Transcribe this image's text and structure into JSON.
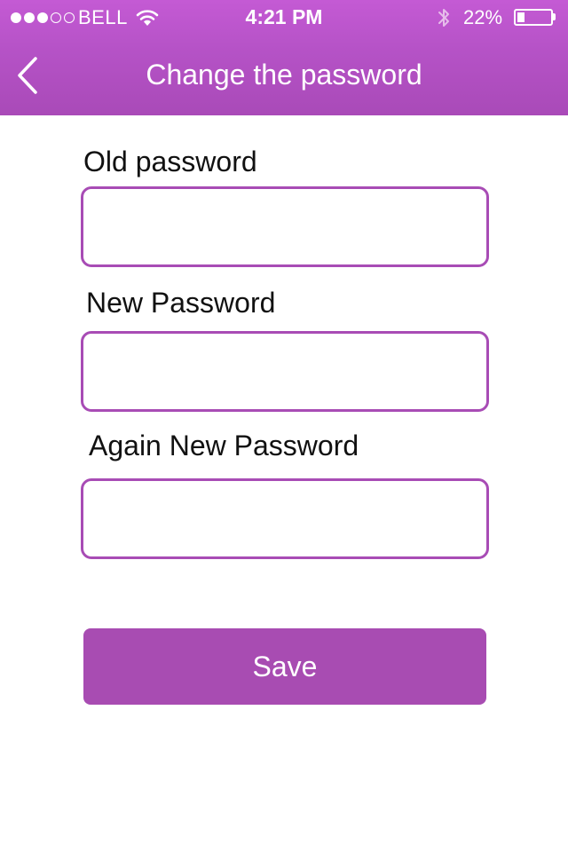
{
  "status_bar": {
    "carrier": "BELL",
    "time": "4:21 PM",
    "battery_percent": "22%",
    "battery_level": 0.22,
    "signal_strength": 3,
    "signal_max": 5,
    "icons": [
      "wifi-icon",
      "bluetooth-icon",
      "battery-icon"
    ]
  },
  "nav": {
    "title": "Change the password",
    "back_icon": "chevron-left-icon"
  },
  "form": {
    "old_password": {
      "label": "Old password",
      "value": "",
      "placeholder": ""
    },
    "new_password": {
      "label": "New Password",
      "value": "",
      "placeholder": ""
    },
    "confirm_password": {
      "label": "Again New Password",
      "value": "",
      "placeholder": ""
    },
    "save_label": "Save"
  },
  "colors": {
    "header_top": "#c45ad4",
    "header_bottom": "#a94ab8",
    "accent": "#a84cb2",
    "field_border": "#a84cb5",
    "background": "#ffffff",
    "text": "#111111"
  }
}
